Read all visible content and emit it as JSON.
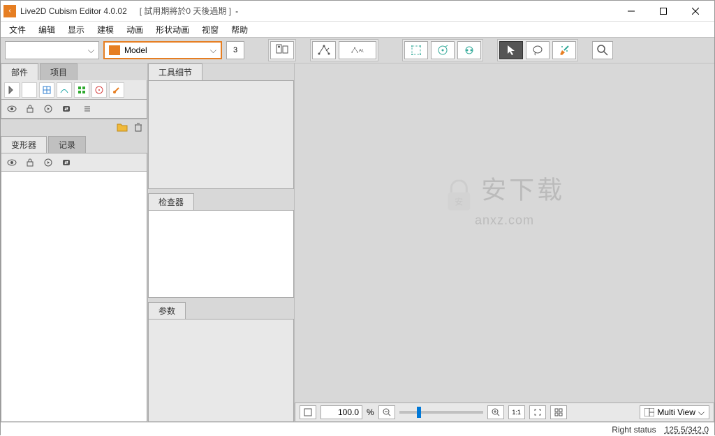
{
  "titlebar": {
    "app_title": "Live2D Cubism Editor 4.0.02",
    "trial": "[ 試用期將於0 天後過期 ]",
    "suffix": "-"
  },
  "menubar": {
    "items": [
      "文件",
      "编辑",
      "显示",
      "建模",
      "动画",
      "形状动画",
      "视窗",
      "帮助"
    ]
  },
  "toolbar": {
    "model_label": "Model",
    "number": "3",
    "multi_view": "Multi View"
  },
  "panels": {
    "parts_tabs": [
      "部件",
      "项目"
    ],
    "deform_tabs": [
      "变形器",
      "记录"
    ],
    "tool_detail_tab": "工具细节",
    "inspector_tab": "检查器",
    "params_tab": "参数"
  },
  "canvas": {
    "zoom_value": "100.0",
    "zoom_unit": "%",
    "ratio": "1:1"
  },
  "statusbar": {
    "right_status": "Right status",
    "coords": "125.5/342.0"
  },
  "watermark": {
    "cn": "安下载",
    "en": "anxz.com"
  }
}
